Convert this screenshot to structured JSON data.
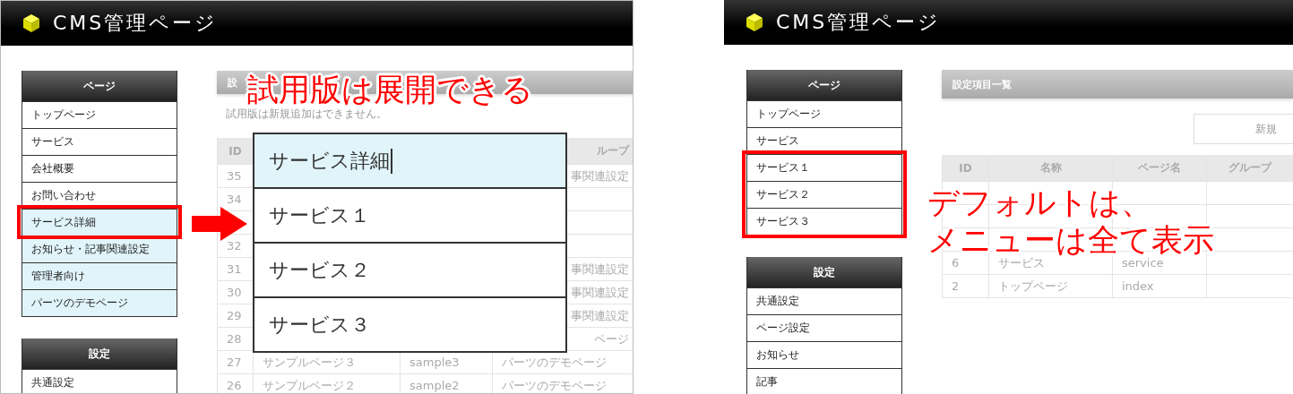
{
  "panels": [
    {
      "header": {
        "title": "CMS管理ページ"
      },
      "sidebar": [
        {
          "title": "ページ",
          "items": [
            {
              "label": "トップページ",
              "highlighted": false,
              "framed": false
            },
            {
              "label": "サービス",
              "highlighted": false,
              "framed": false
            },
            {
              "label": "会社概要",
              "highlighted": false,
              "framed": false
            },
            {
              "label": "お問い合わせ",
              "highlighted": false,
              "framed": false
            },
            {
              "label": "サービス詳細",
              "highlighted": true,
              "framed": true
            },
            {
              "label": "お知らせ・記事関連設定",
              "highlighted": true,
              "framed": false
            },
            {
              "label": "管理者向け",
              "highlighted": true,
              "framed": false
            },
            {
              "label": "パーツのデモページ",
              "highlighted": true,
              "framed": false
            }
          ]
        },
        {
          "title": "設定",
          "items": [
            {
              "label": "共通設定",
              "highlighted": false,
              "framed": false
            }
          ]
        }
      ],
      "main": {
        "title": "設",
        "notice": "試用版は新規追加はできません。",
        "table": {
          "header": {
            "kind": "covered",
            "id": "ID",
            "group": "ループ"
          },
          "rows": [
            {
              "kind": "covered",
              "id": "35",
              "group": "事関連設定"
            },
            {
              "kind": "covered",
              "id": "34"
            },
            {
              "kind": "covered"
            },
            {
              "kind": "covered",
              "id": "32"
            },
            {
              "kind": "covered",
              "id": "31",
              "group": "事関連設定"
            },
            {
              "kind": "covered",
              "id": "30",
              "group": "事関連設定"
            },
            {
              "kind": "covered",
              "id": "29",
              "group": "事関連設定"
            },
            {
              "kind": "covered",
              "id": "28",
              "group": "ページ"
            },
            {
              "kind": "full",
              "id": "27",
              "name": "サンプルページ３",
              "page": "sample3",
              "group": "パーツのデモページ"
            },
            {
              "kind": "full",
              "id": "26",
              "name": "サンプルページ２",
              "page": "sample2",
              "group": "パーツのデモページ"
            }
          ]
        }
      },
      "dropdown": [
        {
          "label": "サービス詳細",
          "selected": true
        },
        {
          "label": "サービス１",
          "selected": false
        },
        {
          "label": "サービス２",
          "selected": false
        },
        {
          "label": "サービス３",
          "selected": false
        }
      ],
      "annotation": [
        "試用版は展開できる"
      ]
    },
    {
      "header": {
        "title": "CMS管理ページ"
      },
      "sidebar": [
        {
          "title": "ページ",
          "items": [
            {
              "label": "トップページ",
              "highlighted": false,
              "framed": false
            },
            {
              "label": "サービス",
              "highlighted": false,
              "framed": false
            },
            {
              "label": "サービス１",
              "highlighted": false,
              "framed": true
            },
            {
              "label": "サービス２",
              "highlighted": false,
              "framed": true
            },
            {
              "label": "サービス３",
              "highlighted": false,
              "framed": true
            }
          ]
        },
        {
          "title": "設定",
          "items": [
            {
              "label": "共通設定",
              "highlighted": false,
              "framed": false
            },
            {
              "label": "ページ設定",
              "highlighted": false,
              "framed": false
            },
            {
              "label": "お知らせ",
              "highlighted": false,
              "framed": false
            },
            {
              "label": "記事",
              "highlighted": false,
              "framed": false
            }
          ]
        }
      ],
      "main": {
        "title": "設定項目一覧",
        "button": "新規",
        "table": {
          "header": {
            "kind": "full",
            "id": "ID",
            "name": "名称",
            "page": "ページ名",
            "group": "グループ"
          },
          "rows": [
            {
              "kind": "full"
            },
            {
              "kind": "full"
            },
            {
              "kind": "full"
            },
            {
              "kind": "full",
              "id": "6",
              "name": "サービス",
              "page": "service"
            },
            {
              "kind": "full",
              "id": "2",
              "name": "トップページ",
              "page": "index"
            }
          ]
        }
      },
      "annotation": [
        "デフォルトは、",
        "メニューは全て表示"
      ]
    }
  ]
}
